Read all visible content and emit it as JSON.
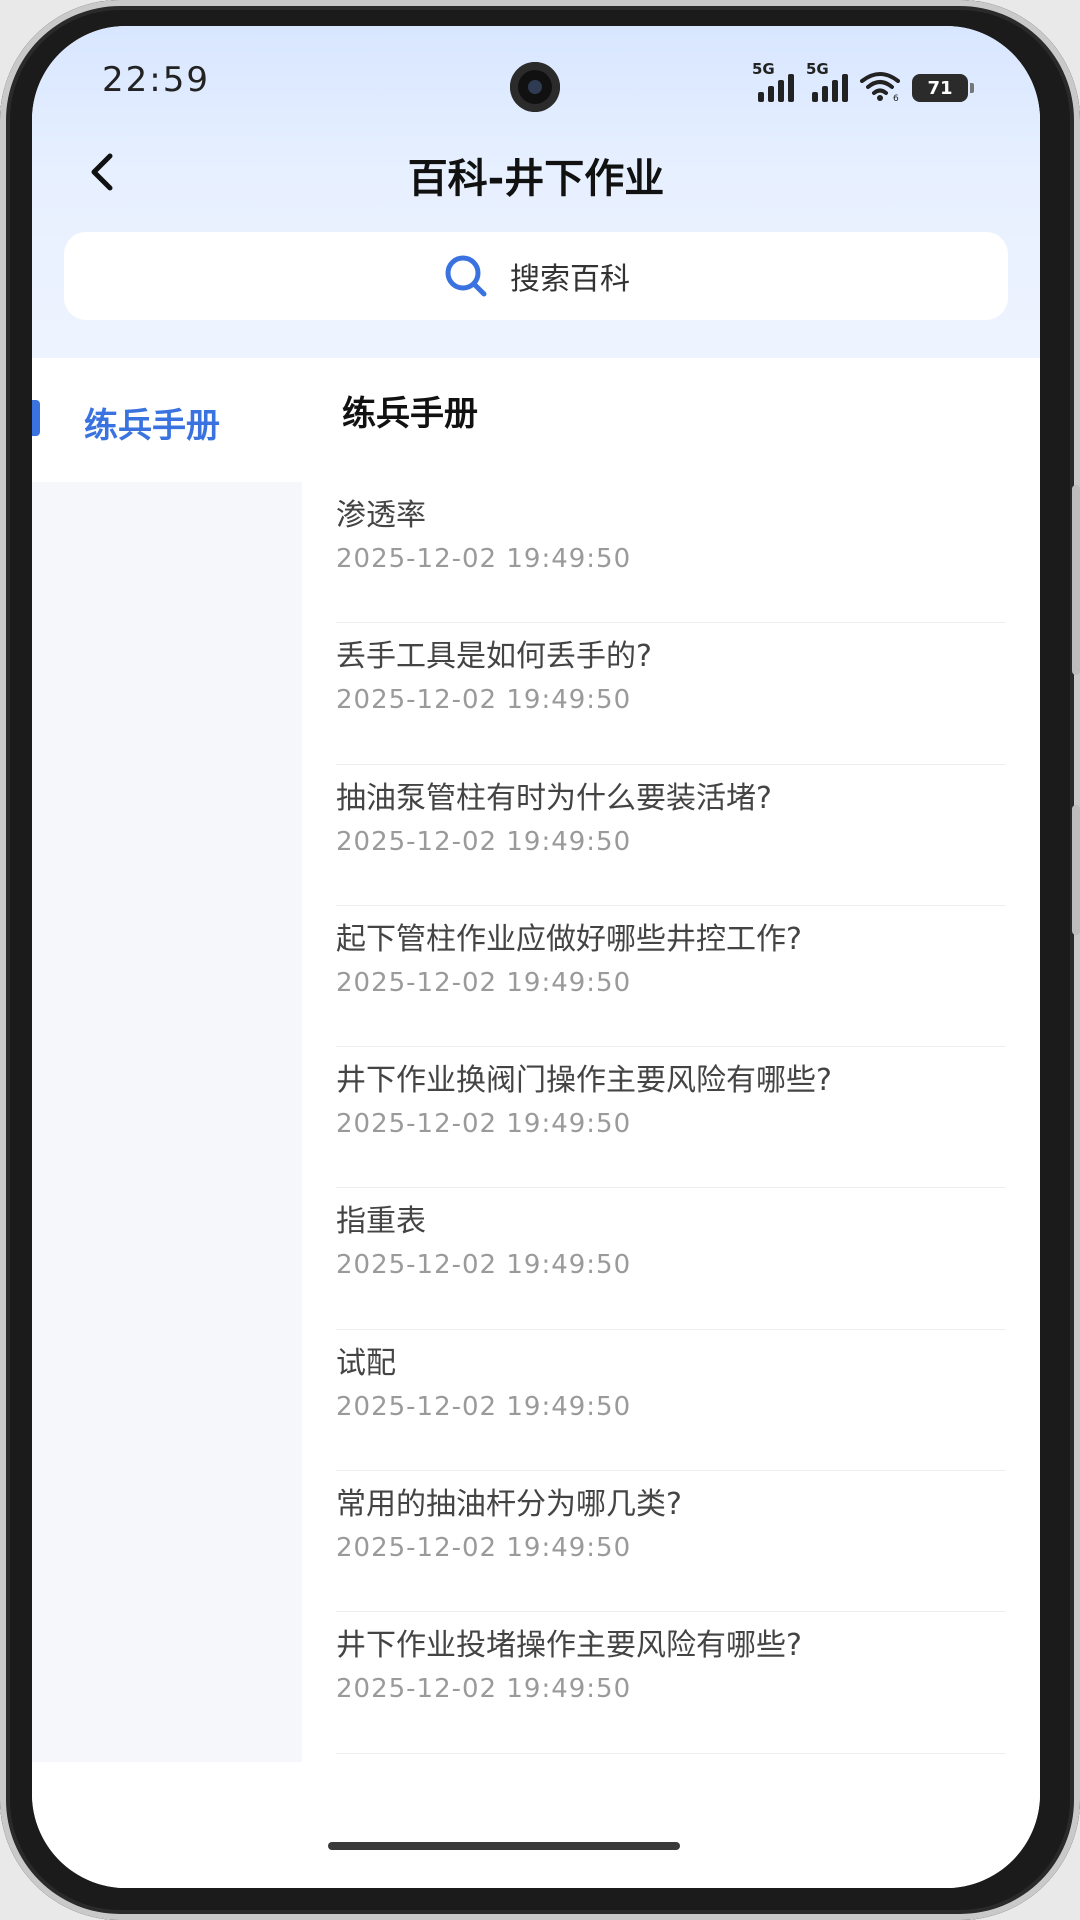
{
  "status_bar": {
    "time": "22:59",
    "signal1_label": "5G",
    "signal2_label": "5G",
    "wifi_label": "6",
    "battery": "71"
  },
  "nav": {
    "title": "百科-井下作业"
  },
  "search": {
    "placeholder": "搜索百科"
  },
  "sidebar": {
    "items": [
      {
        "label": "练兵手册",
        "active": true
      }
    ]
  },
  "content": {
    "section_title": "练兵手册",
    "items": [
      {
        "title": "渗透率",
        "date": "2025-12-02 19:49:50"
      },
      {
        "title": "丢手工具是如何丢手的?",
        "date": "2025-12-02 19:49:50"
      },
      {
        "title": "抽油泵管柱有时为什么要装活堵?",
        "date": "2025-12-02 19:49:50"
      },
      {
        "title": "起下管柱作业应做好哪些井控工作?",
        "date": "2025-12-02 19:49:50"
      },
      {
        "title": "井下作业换阀门操作主要风险有哪些?",
        "date": "2025-12-02 19:49:50"
      },
      {
        "title": "指重表",
        "date": "2025-12-02 19:49:50"
      },
      {
        "title": "试配",
        "date": "2025-12-02 19:49:50"
      },
      {
        "title": "常用的抽油杆分为哪几类?",
        "date": "2025-12-02 19:49:50"
      },
      {
        "title": "井下作业投堵操作主要风险有哪些?",
        "date": "2025-12-02 19:49:50"
      }
    ]
  },
  "colors": {
    "accent": "#3a73df",
    "header_gradient_top": "#d8e6ff",
    "sidebar_bg": "#f5f7fb"
  }
}
